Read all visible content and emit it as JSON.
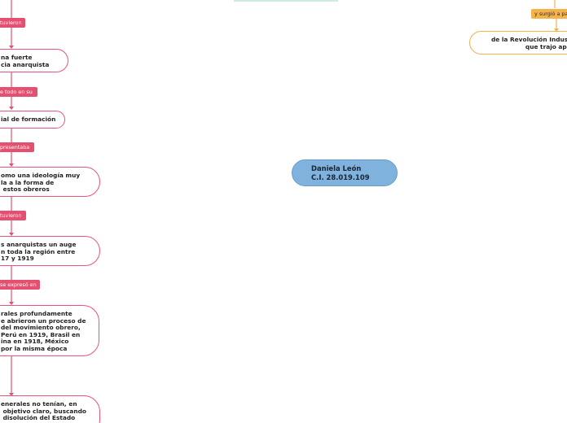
{
  "central_topic": {
    "line1": "Daniela León",
    "line2": "C.I. 28.019.109"
  },
  "left_branch": {
    "tags": [
      "tuvieron",
      "e todo en su",
      "presentaba",
      "tuvieron",
      "se expresó en"
    ],
    "nodes": [
      "na fuerte\ncia anarquista",
      "ial de formación",
      "omo una ideología muy\nla a la forma de\n estos obreros",
      "s anarquistas un auge\nn toda la región entre\n17 y 1919",
      "rales profundamente\ne abrieron un proceso de\ndel movimiento obrero,\nPerú en 1919, Brasil en\nina en 1918, México\npor la misma época",
      "enerales no tenían, en\n objetivo claro, buscando\n disolución del Estado"
    ]
  },
  "right_branch": {
    "tag": "y surgió a pa",
    "node": "de la Revolución Indust\nque trajo apa"
  },
  "colors": {
    "pink": "#e4506f",
    "orange": "#f5b24a",
    "central": "#7fb2dc"
  }
}
